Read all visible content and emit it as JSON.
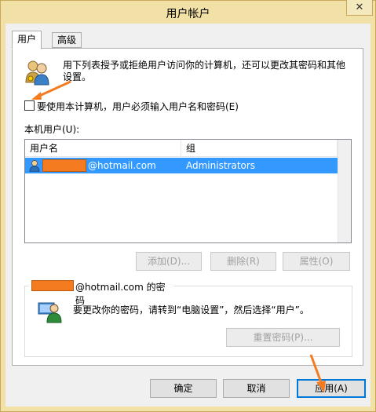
{
  "window": {
    "title": "用户帐户",
    "close_glyph": "✕"
  },
  "tabs": [
    {
      "label": "用户",
      "active": true
    },
    {
      "label": "高级",
      "active": false
    }
  ],
  "intro_text_line1": "用下列表授予或拒绝用户访问你的计算机，还可以更改其密码和其他",
  "intro_text_line2": "设置。",
  "require_login_checkbox": {
    "label": "要使用本计算机，用户必须输入用户名和密码(E)",
    "checked": false
  },
  "users_label": "本机用户(U):",
  "users_table": {
    "columns": [
      "用户名",
      "组"
    ],
    "rows": [
      {
        "username_suffix": "@hotmail.com",
        "group": "Administrators",
        "selected": true
      }
    ]
  },
  "user_buttons": {
    "add": "添加(D)...",
    "remove": "删除(R)",
    "properties": "属性(O)"
  },
  "password_group": {
    "title_suffix": "@hotmail.com 的密码",
    "message": "要更改你的密码，请转到“电脑设置”，然后选择“用户”。",
    "reset_button": "重置密码(P)..."
  },
  "dialog_buttons": {
    "ok": "确定",
    "cancel": "取消",
    "apply": "应用(A)"
  },
  "colors": {
    "annotation": "#f47b20",
    "selection": "#3399ff",
    "window_frame": "#f2e1a6"
  }
}
